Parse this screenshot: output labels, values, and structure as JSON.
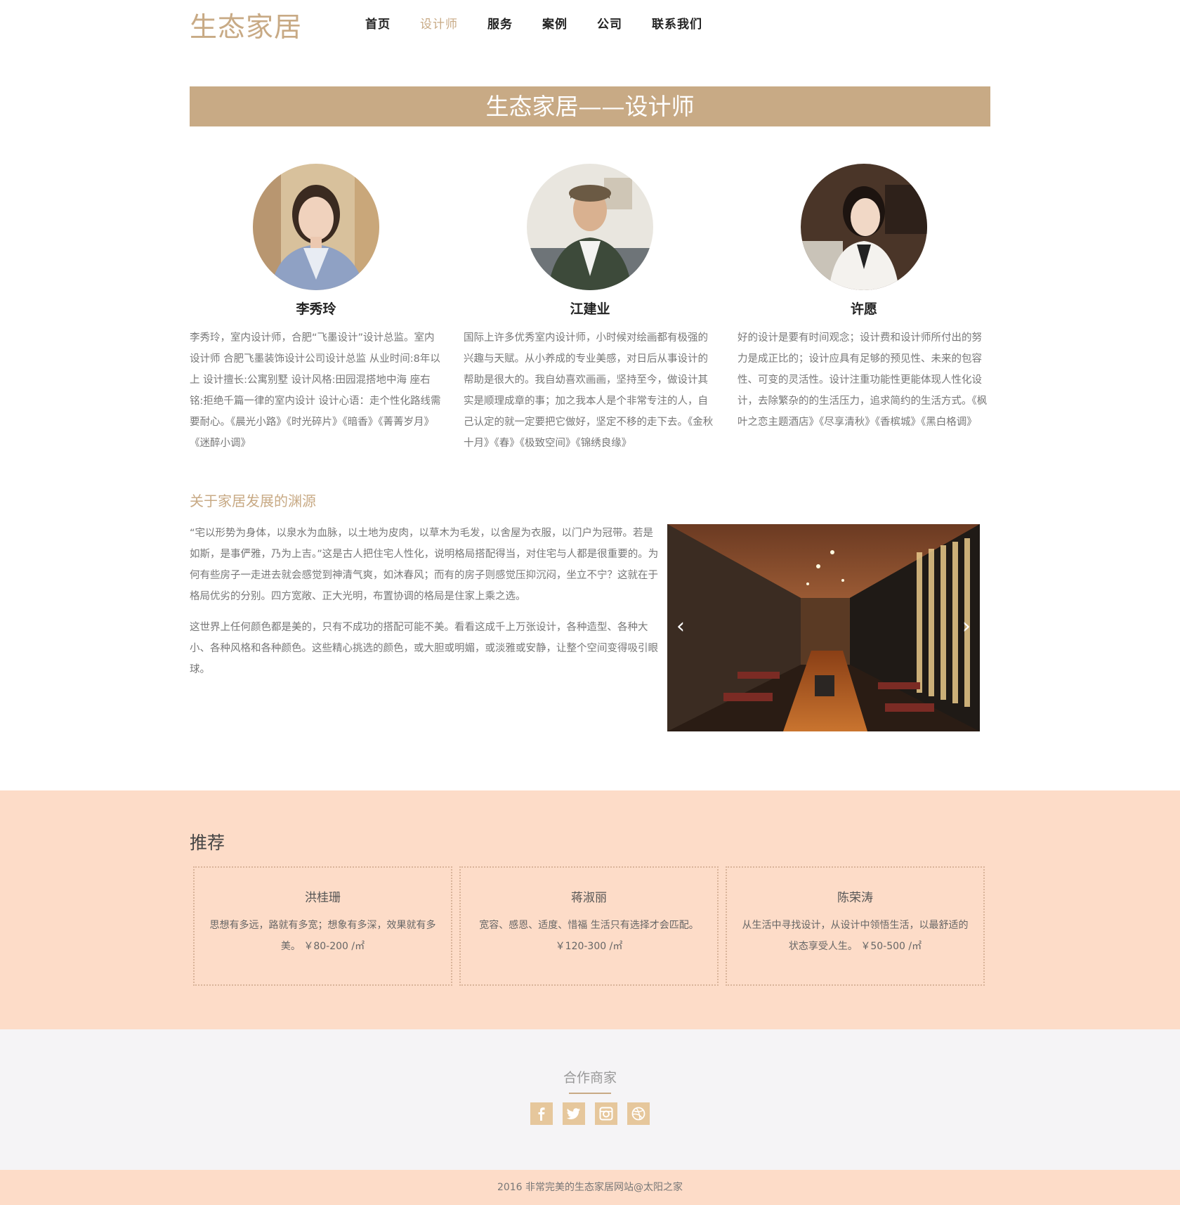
{
  "header": {
    "logo": "生态家居",
    "nav": [
      "首页",
      "设计师",
      "服务",
      "案例",
      "公司",
      "联系我们"
    ]
  },
  "banner": {
    "title": "生态家居——设计师"
  },
  "designers": [
    {
      "name": "李秀玲",
      "bio": "李秀玲，室内设计师，合肥“飞墨设计”设计总监。室内设计师 合肥飞墨装饰设计公司设计总监 从业时间:8年以上 设计擅长:公寓别墅 设计风格:田园混搭地中海 座右铭:拒绝千篇一律的室内设计 设计心语：走个性化路线需要耐心。《晨光小路》《时光碎片》《暗香》《菁菁岁月》《迷醉小调》"
    },
    {
      "name": "江建业",
      "bio": "国际上许多优秀室内设计师，小时候对绘画都有极强的兴趣与天赋。从小养成的专业美感，对日后从事设计的帮助是很大的。我自幼喜欢画画，坚持至今，做设计其实是顺理成章的事；加之我本人是个非常专注的人，自己认定的就一定要把它做好，坚定不移的走下去。《金秋十月》《春》《极致空间》《锦绣良缘》"
    },
    {
      "name": "许愿",
      "bio": "好的设计是要有时间观念；设计费和设计师所付出的努力是成正比的；设计应具有足够的预见性、未来的包容性、可变的灵活性。设计注重功能性更能体现人性化设计，去除繁杂的的生活压力，追求简约的生活方式。《枫叶之恋主题酒店》《尽享清秋》《香槟城》《黑白格调》"
    }
  ],
  "history": {
    "title": "关于家居发展的渊源",
    "paragraphs": [
      "“宅以形势为身体，以泉水为血脉，以土地为皮肉，以草木为毛发，以舍屋为衣服，以门户为冠带。若是如斯，是事俨雅，乃为上吉。”这是古人把住宅人性化，说明格局搭配得当，对住宅与人都是很重要的。为何有些房子一走进去就会感觉到神清气爽，如沐春风；而有的房子则感觉压抑沉闷，坐立不宁？这就在于格局优劣的分别。四方宽敞、正大光明，布置协调的格局是住家上乘之选。",
      "这世界上任何颜色都是美的，只有不成功的搭配可能不美。看看这成千上万张设计，各种造型、各种大小、各种风格和各种颜色。这些精心挑选的颜色，或大胆或明媚，或淡雅或安静，让整个空间变得吸引眼球。"
    ],
    "carousel": {
      "prev": "‹",
      "next": "›"
    }
  },
  "recommend": {
    "title": "推荐",
    "cards": [
      {
        "name": "洪桂珊",
        "text": "思想有多远，路就有多宽；想象有多深，效果就有多美。 ￥80-200 /㎡"
      },
      {
        "name": "蒋淑丽",
        "text": "宽容、感恩、适度、惜福 生活只有选择才会匹配。 ￥120-300 /㎡"
      },
      {
        "name": "陈荣涛",
        "text": "从生活中寻找设计，从设计中领悟生活，以最舒适的状态享受人生。 ￥50-500 /㎡"
      }
    ]
  },
  "partners": {
    "title": "合作商家",
    "icons": [
      "facebook-icon",
      "twitter-icon",
      "instagram-icon",
      "dribbble-icon"
    ]
  },
  "footer": {
    "text": "2016 非常完美的生态家居网站@太阳之家"
  },
  "colors": {
    "accent": "#c8aa85",
    "peach": "#fddcc8",
    "light_gray": "#f5f4f6"
  }
}
